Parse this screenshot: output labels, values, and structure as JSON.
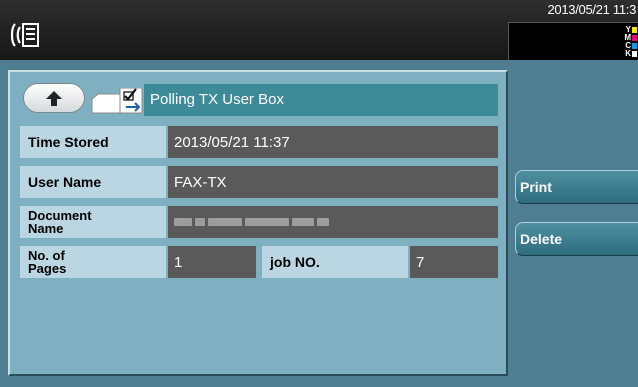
{
  "header": {
    "datetime": "2013/05/21 11:3",
    "toner": [
      {
        "label": "Y",
        "color": "#ffe600"
      },
      {
        "label": "M",
        "color": "#e6007e"
      },
      {
        "label": "C",
        "color": "#00a0e9"
      },
      {
        "label": "K",
        "color": "#ffffff"
      }
    ]
  },
  "box": {
    "title": "Polling TX User Box"
  },
  "fields": {
    "time_stored_label": "Time Stored",
    "time_stored_value": "2013/05/21 11:37",
    "user_name_label": "User Name",
    "user_name_value": "FAX-TX",
    "document_name_label_line1": "Document",
    "document_name_label_line2": "Name",
    "pages_label_line1": "No. of",
    "pages_label_line2": "Pages",
    "pages_value": "1",
    "job_no_label": "job NO.",
    "job_no_value": "7"
  },
  "actions": {
    "print_label": "Print",
    "delete_label": "Delete"
  }
}
